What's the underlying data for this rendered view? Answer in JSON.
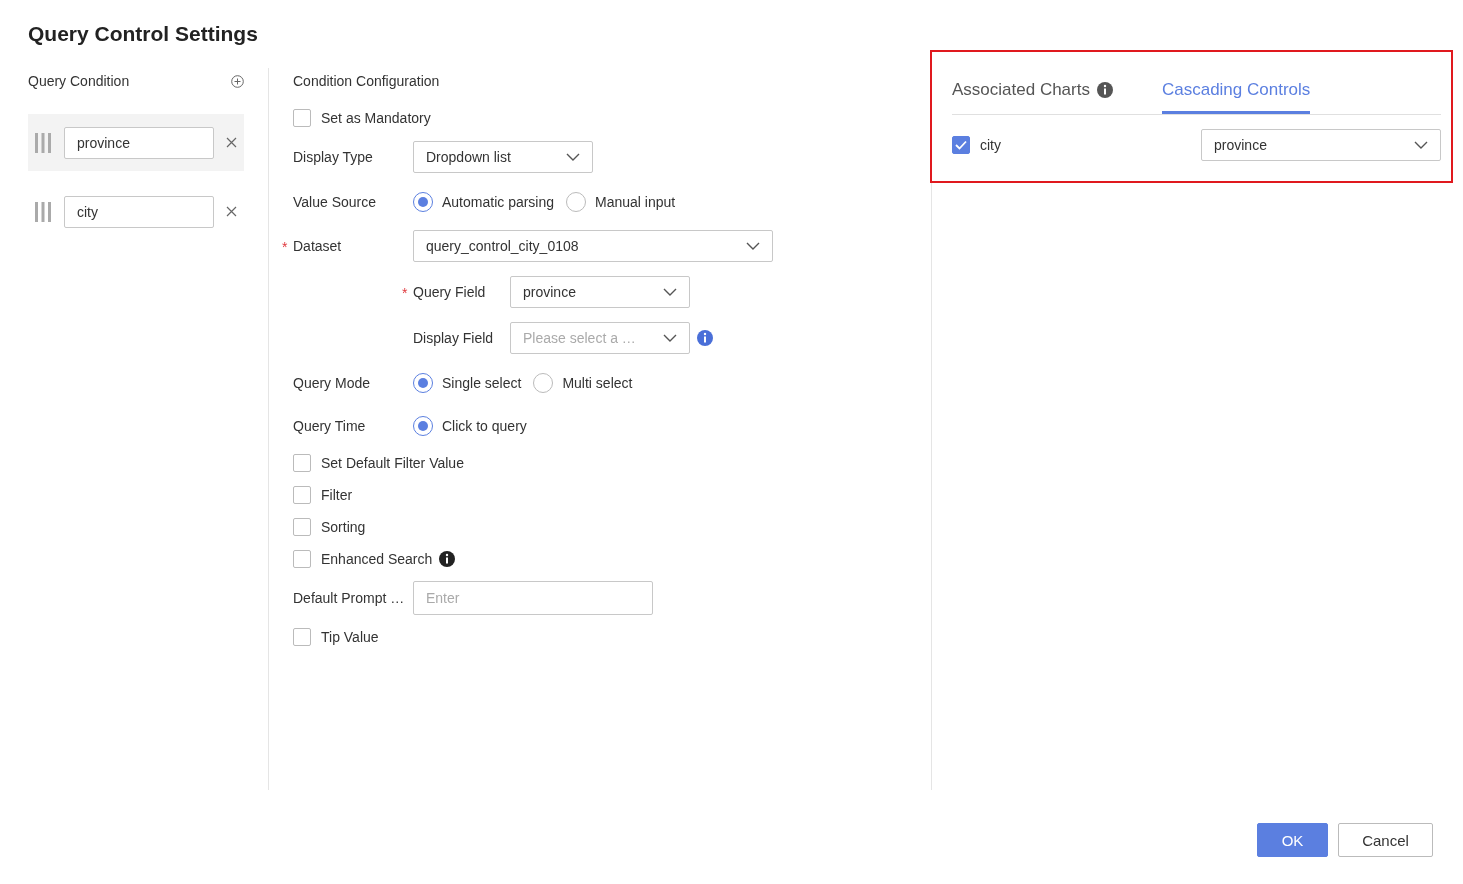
{
  "dialog": {
    "title": "Query Control Settings"
  },
  "conditions_panel": {
    "title": "Query Condition",
    "conditions": [
      {
        "value": "province",
        "selected": true
      },
      {
        "value": "city",
        "selected": false
      }
    ]
  },
  "config": {
    "title": "Condition Configuration",
    "rows": [
      {
        "kind": "checkbox",
        "label": "Set as Mandatory",
        "checked": false
      },
      {
        "kind": "select",
        "label": "Display Type",
        "value": "Dropdown list"
      },
      {
        "kind": "radio",
        "label": "Value Source",
        "options": [
          {
            "label": "Automatic parsing",
            "selected": true
          },
          {
            "label": "Manual input",
            "selected": false
          }
        ]
      },
      {
        "kind": "select",
        "label": "Dataset",
        "value": "query_control_city_0108",
        "required_mark": "*",
        "wide": true
      },
      {
        "kind": "subselect",
        "label": "Query Field",
        "value": "province",
        "required_mark": "*"
      },
      {
        "kind": "subselect",
        "label": "Display Field",
        "placeholder": "Please select a …",
        "info": true
      },
      {
        "kind": "radio",
        "label": "Query Mode",
        "options": [
          {
            "label": "Single select",
            "selected": true
          },
          {
            "label": "Multi select",
            "selected": false
          }
        ]
      },
      {
        "kind": "radio",
        "label": "Query Time",
        "options": [
          {
            "label": "Click to query",
            "selected": true
          }
        ]
      },
      {
        "kind": "checkbox",
        "label": "Set Default Filter Value",
        "checked": false
      },
      {
        "kind": "checkbox",
        "label": "Filter",
        "checked": false
      },
      {
        "kind": "checkbox",
        "label": "Sorting",
        "checked": false
      },
      {
        "kind": "checkbox",
        "label": "Enhanced Search",
        "checked": false,
        "info": true
      },
      {
        "kind": "input",
        "label": "Default Prompt …",
        "placeholder": "Enter"
      },
      {
        "kind": "checkbox",
        "label": "Tip Value",
        "checked": false
      }
    ]
  },
  "links_panel": {
    "highlighted": true,
    "tabs": [
      {
        "label": "Associated Charts",
        "selected": false,
        "info": true
      },
      {
        "label": "Cascading Controls",
        "selected": true
      }
    ],
    "cascades": [
      {
        "label": "city",
        "checked": true,
        "value": "province"
      }
    ]
  },
  "buttons": [
    {
      "label": "OK",
      "kind": "primary"
    },
    {
      "label": "Cancel",
      "kind": "default"
    }
  ]
}
